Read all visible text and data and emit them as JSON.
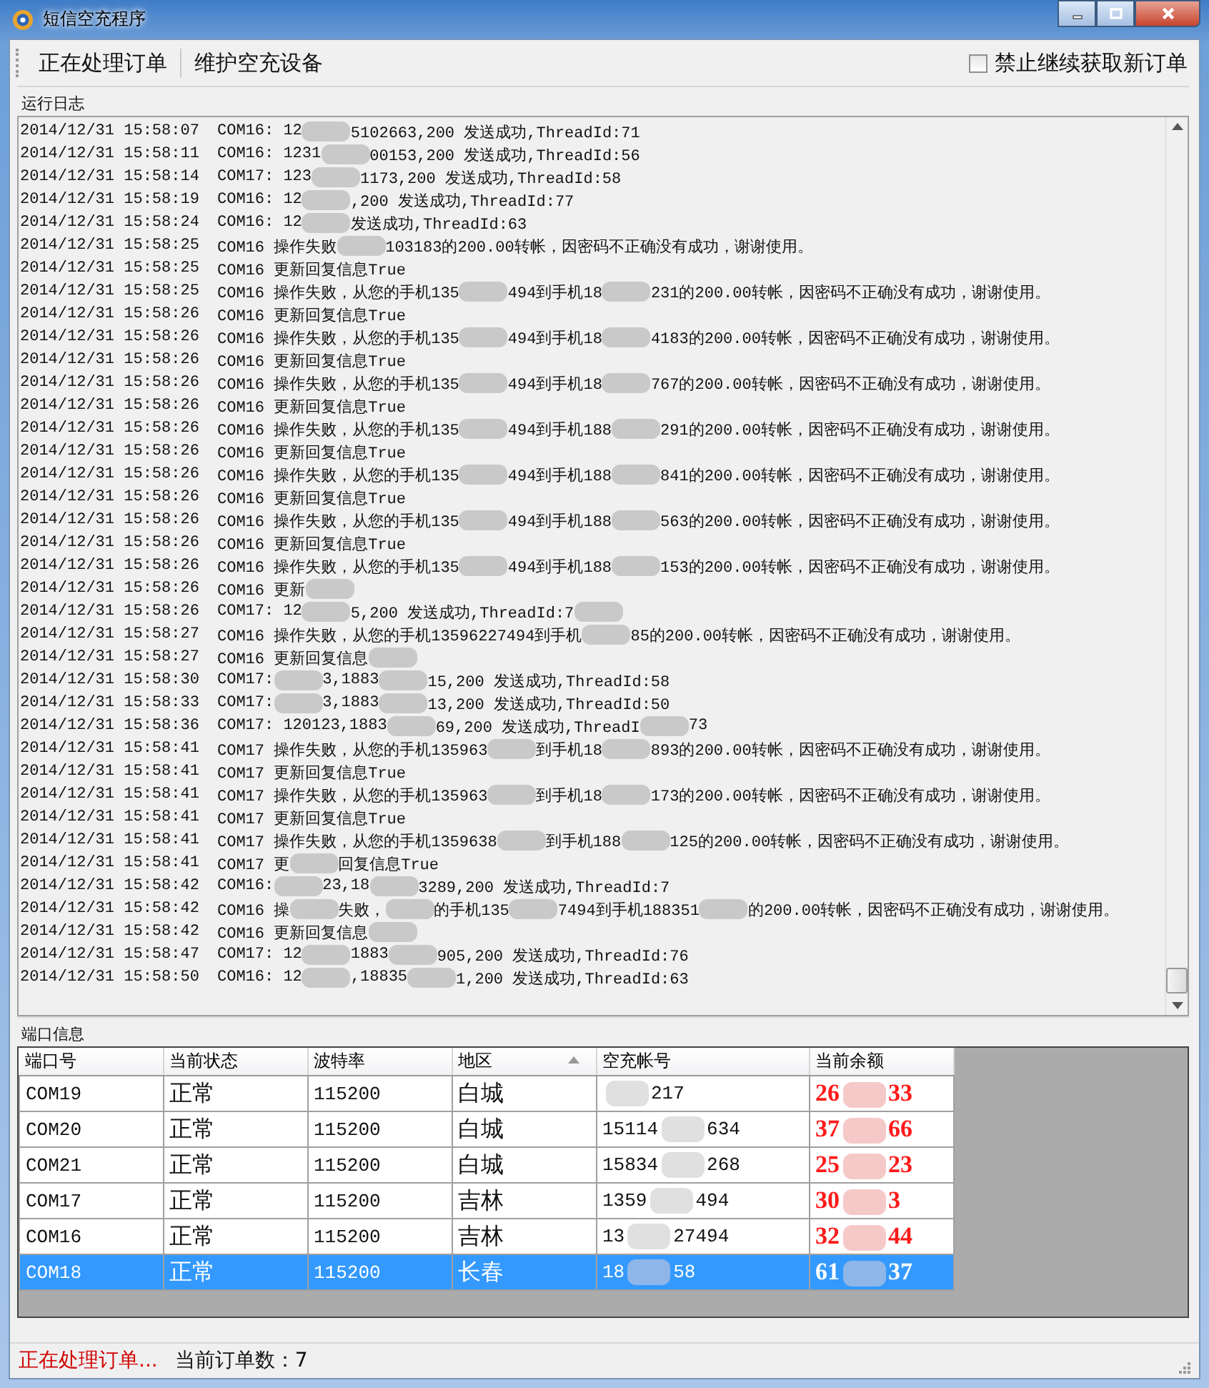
{
  "window": {
    "title": "短信空充程序"
  },
  "toolbar": {
    "items": [
      {
        "label": "正在处理订单"
      },
      {
        "label": "维护空充设备"
      }
    ],
    "stop_checkbox": {
      "label": "禁止继续获取新订单",
      "checked": false
    }
  },
  "log": {
    "title": "运行日志",
    "lines": [
      {
        "time": "2014/12/31 15:58:07",
        "parts": [
          "COM16: 12",
          {
            "kind": "redacted"
          },
          "5102663,200 发送成功,ThreadId:71"
        ]
      },
      {
        "time": "2014/12/31 15:58:11",
        "parts": [
          "COM16: 1231",
          {
            "kind": "redacted"
          },
          "00153,200 发送成功,ThreadId:56"
        ]
      },
      {
        "time": "2014/12/31 15:58:14",
        "parts": [
          "COM17: 123",
          {
            "kind": "redacted"
          },
          "1173,200 发送成功,ThreadId:58"
        ]
      },
      {
        "time": "2014/12/31 15:58:19",
        "parts": [
          "COM16: 12",
          {
            "kind": "redacted"
          },
          ",200 发送成功,ThreadId:77"
        ]
      },
      {
        "time": "2014/12/31 15:58:24",
        "parts": [
          "COM16: 12",
          {
            "kind": "redacted"
          },
          "发送成功,ThreadId:63"
        ]
      },
      {
        "time": "2014/12/31 15:58:25",
        "parts": [
          "COM16 操作失败",
          {
            "kind": "redacted"
          },
          "103183的200.00转帐，因密码不正确没有成功，谢谢使用。"
        ]
      },
      {
        "time": "2014/12/31 15:58:25",
        "parts": [
          "COM16 更新回复信息True"
        ]
      },
      {
        "time": "2014/12/31 15:58:25",
        "parts": [
          "COM16 操作失败，从您的手机135",
          {
            "kind": "redacted"
          },
          "494到手机18",
          {
            "kind": "redacted"
          },
          "231的200.00转帐，因密码不正确没有成功，谢谢使用。"
        ]
      },
      {
        "time": "2014/12/31 15:58:26",
        "parts": [
          "COM16 更新回复信息True"
        ]
      },
      {
        "time": "2014/12/31 15:58:26",
        "parts": [
          "COM16 操作失败，从您的手机135",
          {
            "kind": "redacted"
          },
          "494到手机18",
          {
            "kind": "redacted"
          },
          "4183的200.00转帐，因密码不正确没有成功，谢谢使用。"
        ]
      },
      {
        "time": "2014/12/31 15:58:26",
        "parts": [
          "COM16 更新回复信息True"
        ]
      },
      {
        "time": "2014/12/31 15:58:26",
        "parts": [
          "COM16 操作失败，从您的手机135",
          {
            "kind": "redacted"
          },
          "494到手机18",
          {
            "kind": "redacted"
          },
          "767的200.00转帐，因密码不正确没有成功，谢谢使用。"
        ]
      },
      {
        "time": "2014/12/31 15:58:26",
        "parts": [
          "COM16 更新回复信息True"
        ]
      },
      {
        "time": "2014/12/31 15:58:26",
        "parts": [
          "COM16 操作失败，从您的手机135",
          {
            "kind": "redacted"
          },
          "494到手机188",
          {
            "kind": "redacted"
          },
          "291的200.00转帐，因密码不正确没有成功，谢谢使用。"
        ]
      },
      {
        "time": "2014/12/31 15:58:26",
        "parts": [
          "COM16 更新回复信息True"
        ]
      },
      {
        "time": "2014/12/31 15:58:26",
        "parts": [
          "COM16 操作失败，从您的手机135",
          {
            "kind": "redacted"
          },
          "494到手机188",
          {
            "kind": "redacted"
          },
          "841的200.00转帐，因密码不正确没有成功，谢谢使用。"
        ]
      },
      {
        "time": "2014/12/31 15:58:26",
        "parts": [
          "COM16 更新回复信息True"
        ]
      },
      {
        "time": "2014/12/31 15:58:26",
        "parts": [
          "COM16 操作失败，从您的手机135",
          {
            "kind": "redacted"
          },
          "494到手机188",
          {
            "kind": "redacted"
          },
          "563的200.00转帐，因密码不正确没有成功，谢谢使用。"
        ]
      },
      {
        "time": "2014/12/31 15:58:26",
        "parts": [
          "COM16 更新回复信息True"
        ]
      },
      {
        "time": "2014/12/31 15:58:26",
        "parts": [
          "COM16 操作失败，从您的手机135",
          {
            "kind": "redacted"
          },
          "494到手机188",
          {
            "kind": "redacted"
          },
          "153的200.00转帐，因密码不正确没有成功，谢谢使用。"
        ]
      },
      {
        "time": "2014/12/31 15:58:26",
        "parts": [
          "COM16 更新",
          {
            "kind": "redacted"
          }
        ]
      },
      {
        "time": "2014/12/31 15:58:26",
        "parts": [
          "COM17: 12",
          {
            "kind": "redacted"
          },
          "5,200 发送成功,ThreadId:7",
          {
            "kind": "redacted"
          }
        ]
      },
      {
        "time": "2014/12/31 15:58:27",
        "parts": [
          "COM16 操作失败，从您的手机13596227494到手机",
          {
            "kind": "redacted"
          },
          "85的200.00转帐，因密码不正确没有成功，谢谢使用。"
        ]
      },
      {
        "time": "2014/12/31 15:58:27",
        "parts": [
          "COM16 更新回复信息",
          {
            "kind": "redacted"
          }
        ]
      },
      {
        "time": "2014/12/31 15:58:30",
        "parts": [
          "COM17: ",
          {
            "kind": "redacted"
          },
          "3,1883",
          {
            "kind": "redacted"
          },
          "15,200 发送成功,ThreadId:58"
        ]
      },
      {
        "time": "2014/12/31 15:58:33",
        "parts": [
          "COM17: ",
          {
            "kind": "redacted"
          },
          "3,1883",
          {
            "kind": "redacted"
          },
          "13,200 发送成功,ThreadId:50"
        ]
      },
      {
        "time": "2014/12/31 15:58:36",
        "parts": [
          "COM17: 120123,1883",
          {
            "kind": "redacted"
          },
          "69,200 发送成功,ThreadI",
          {
            "kind": "redacted"
          },
          "73"
        ]
      },
      {
        "time": "2014/12/31 15:58:41",
        "parts": [
          "COM17 操作失败，从您的手机135963",
          {
            "kind": "redacted"
          },
          "到手机18",
          {
            "kind": "redacted"
          },
          "893的200.00转帐，因密码不正确没有成功，谢谢使用。"
        ]
      },
      {
        "time": "2014/12/31 15:58:41",
        "parts": [
          "COM17 更新回复信息True"
        ]
      },
      {
        "time": "2014/12/31 15:58:41",
        "parts": [
          "COM17 操作失败，从您的手机135963",
          {
            "kind": "redacted"
          },
          "到手机18",
          {
            "kind": "redacted"
          },
          "173的200.00转帐，因密码不正确没有成功，谢谢使用。"
        ]
      },
      {
        "time": "2014/12/31 15:58:41",
        "parts": [
          "COM17 更新回复信息True"
        ]
      },
      {
        "time": "2014/12/31 15:58:41",
        "parts": [
          "COM17 操作失败，从您的手机1359638",
          {
            "kind": "redacted"
          },
          "到手机188",
          {
            "kind": "redacted"
          },
          "125的200.00转帐，因密码不正确没有成功，谢谢使用。"
        ]
      },
      {
        "time": "2014/12/31 15:58:41",
        "parts": [
          "COM17 更",
          {
            "kind": "redacted"
          },
          "回复信息True"
        ]
      },
      {
        "time": "2014/12/31 15:58:42",
        "parts": [
          "COM16: ",
          {
            "kind": "redacted"
          },
          "23,18",
          {
            "kind": "redacted"
          },
          "3289,200 发送成功,ThreadId:7"
        ]
      },
      {
        "time": "2014/12/31 15:58:42",
        "parts": [
          "COM16 操",
          {
            "kind": "redacted"
          },
          "失败，",
          {
            "kind": "redacted"
          },
          "的手机135",
          {
            "kind": "redacted"
          },
          "7494到手机188351",
          {
            "kind": "redacted"
          },
          "的200.00转帐，因密码不正确没有成功，谢谢使用。"
        ]
      },
      {
        "time": "2014/12/31 15:58:42",
        "parts": [
          "COM16 更新回复信息",
          {
            "kind": "redacted"
          }
        ]
      },
      {
        "time": "2014/12/31 15:58:47",
        "parts": [
          "COM17: 12",
          {
            "kind": "redacted"
          },
          "1883",
          {
            "kind": "redacted"
          },
          "905,200 发送成功,ThreadId:76"
        ]
      },
      {
        "time": "2014/12/31 15:58:50",
        "parts": [
          "COM16: 12",
          {
            "kind": "redacted"
          },
          ",18835",
          {
            "kind": "redacted"
          },
          "1,200 发送成功,ThreadId:63"
        ]
      }
    ]
  },
  "ports": {
    "title": "端口信息",
    "columns": [
      {
        "label": "端口号",
        "sorted": false
      },
      {
        "label": "当前状态",
        "sorted": false
      },
      {
        "label": "波特率",
        "sorted": false
      },
      {
        "label": "地区",
        "sorted": true
      },
      {
        "label": "空充帐号",
        "sorted": false
      },
      {
        "label": "当前余额",
        "sorted": false
      }
    ],
    "rows": [
      {
        "selected": false,
        "cells": [
          [
            "COM19"
          ],
          [
            "正常"
          ],
          [
            "115200"
          ],
          [
            "白城"
          ],
          [
            {
              "kind": "redacted"
            },
            "217"
          ],
          [
            "26",
            {
              "kind": "redacted"
            },
            "33"
          ]
        ]
      },
      {
        "selected": false,
        "cells": [
          [
            "COM20"
          ],
          [
            "正常"
          ],
          [
            "115200"
          ],
          [
            "白城"
          ],
          [
            "15114",
            {
              "kind": "redacted"
            },
            "634"
          ],
          [
            "37",
            {
              "kind": "redacted"
            },
            "66"
          ]
        ]
      },
      {
        "selected": false,
        "cells": [
          [
            "COM21"
          ],
          [
            "正常"
          ],
          [
            "115200"
          ],
          [
            "白城"
          ],
          [
            "15834",
            {
              "kind": "redacted"
            },
            "268"
          ],
          [
            "25",
            {
              "kind": "redacted"
            },
            "23"
          ]
        ]
      },
      {
        "selected": false,
        "cells": [
          [
            "COM17"
          ],
          [
            "正常"
          ],
          [
            "115200"
          ],
          [
            "吉林"
          ],
          [
            "1359",
            {
              "kind": "redacted"
            },
            "494"
          ],
          [
            "30",
            {
              "kind": "redacted"
            },
            "3"
          ]
        ]
      },
      {
        "selected": false,
        "cells": [
          [
            "COM16"
          ],
          [
            "正常"
          ],
          [
            "115200"
          ],
          [
            "吉林"
          ],
          [
            "13",
            {
              "kind": "redacted"
            },
            "27494"
          ],
          [
            "32",
            {
              "kind": "redacted"
            },
            "44"
          ]
        ]
      },
      {
        "selected": true,
        "cells": [
          [
            "COM18"
          ],
          [
            "正常"
          ],
          [
            "115200"
          ],
          [
            "长春"
          ],
          [
            "18",
            {
              "kind": "redacted"
            },
            "58"
          ],
          [
            "61",
            {
              "kind": "redacted"
            },
            "37"
          ]
        ]
      }
    ]
  },
  "status_bar": {
    "state": "正在处理订单...",
    "count": "当前订单数：7"
  }
}
